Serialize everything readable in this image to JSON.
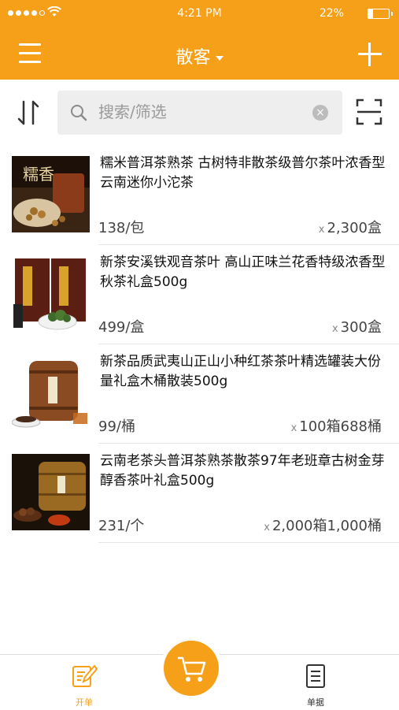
{
  "status_bar": {
    "time": "4:21 PM",
    "battery": "22%"
  },
  "navbar": {
    "title": "散客"
  },
  "search": {
    "placeholder": "搜索/筛选"
  },
  "products": [
    {
      "name": "糯米普洱茶熟茶 古树特非散茶级普尔茶叶浓香型云南迷你小沱茶",
      "price": "138/包",
      "qty": "2,300盒"
    },
    {
      "name": "新茶安溪铁观音茶叶 高山正味兰花香特级浓香型秋茶礼盒500g",
      "price": "499/盒",
      "qty": "300盒"
    },
    {
      "name": "新茶品质武夷山正山小种红茶茶叶精选罐装大份量礼盒木桶散装500g",
      "price": "99/桶",
      "qty": "100箱688桶"
    },
    {
      "name": "云南老茶头普洱茶熟茶散茶97年老班章古树金芽醇香茶叶礼盒500g",
      "price": "231/个",
      "qty": "2,000箱1,000桶"
    }
  ],
  "tabbar": {
    "open_order": "开单",
    "documents": "单据"
  },
  "colors": {
    "accent": "#f6a01a"
  },
  "icons": {
    "menu": "menu-icon",
    "add": "plus-icon",
    "sort": "sort-icon",
    "scan": "scan-icon",
    "cart": "cart-icon",
    "edit": "edit-note-icon",
    "doc": "document-icon"
  }
}
